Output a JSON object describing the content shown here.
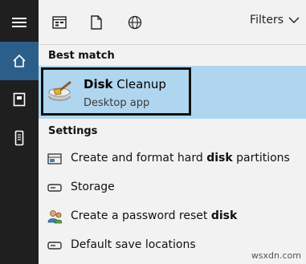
{
  "toolbar": {
    "filters_label": "Filters"
  },
  "sections": {
    "best_match": "Best match",
    "settings": "Settings"
  },
  "best_match": {
    "title_bold": "Disk",
    "title_rest": " Cleanup",
    "subtitle": "Desktop app"
  },
  "settings_items": [
    {
      "pre": "Create and format hard ",
      "bold": "disk",
      "post": " partitions"
    },
    {
      "pre": "Storage",
      "bold": "",
      "post": ""
    },
    {
      "pre": "Create a password reset ",
      "bold": "disk",
      "post": ""
    },
    {
      "pre": "Default save locations",
      "bold": "",
      "post": ""
    }
  ],
  "watermark": "wsxdn.com",
  "colors": {
    "rail": "#1f1f1f",
    "rail_active": "#2b5f89",
    "highlight": "#b0d6ef",
    "background": "#f2f2f2"
  }
}
